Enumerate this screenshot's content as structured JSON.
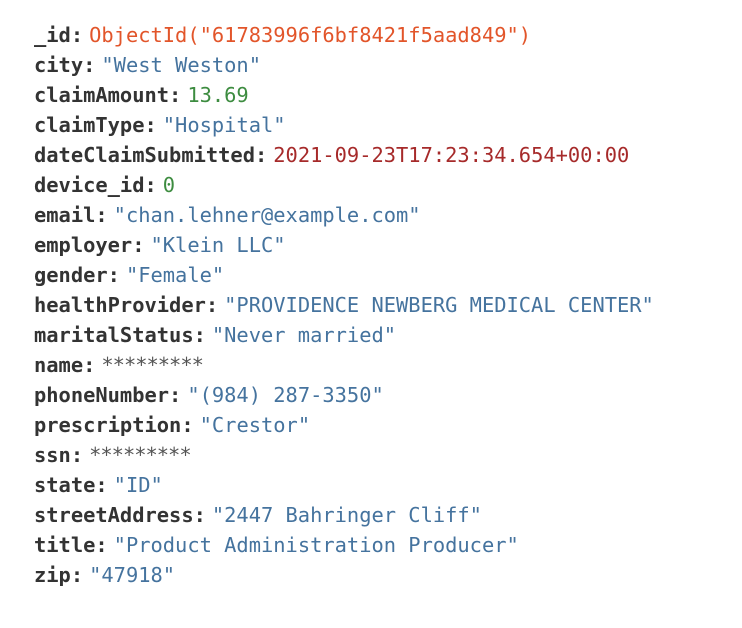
{
  "document": {
    "fields": [
      {
        "key": "_id",
        "value": "ObjectId(\"61783996f6bf8421f5aad849\")",
        "type": "objectid"
      },
      {
        "key": "city",
        "value": "\"West Weston\"",
        "type": "string"
      },
      {
        "key": "claimAmount",
        "value": "13.69",
        "type": "number"
      },
      {
        "key": "claimType",
        "value": "\"Hospital\"",
        "type": "string"
      },
      {
        "key": "dateClaimSubmitted",
        "value": "2021-09-23T17:23:34.654+00:00",
        "type": "date"
      },
      {
        "key": "device_id",
        "value": "0",
        "type": "number"
      },
      {
        "key": "email",
        "value": "\"chan.lehner@example.com\"",
        "type": "string"
      },
      {
        "key": "employer",
        "value": "\"Klein LLC\"",
        "type": "string"
      },
      {
        "key": "gender",
        "value": "\"Female\"",
        "type": "string"
      },
      {
        "key": "healthProvider",
        "value": "\"PROVIDENCE NEWBERG MEDICAL CENTER\"",
        "type": "string"
      },
      {
        "key": "maritalStatus",
        "value": "\"Never married\"",
        "type": "string"
      },
      {
        "key": "name",
        "value": "*********",
        "type": "masked"
      },
      {
        "key": "phoneNumber",
        "value": "\"(984) 287-3350\"",
        "type": "string"
      },
      {
        "key": "prescription",
        "value": "\"Crestor\"",
        "type": "string"
      },
      {
        "key": "ssn",
        "value": "*********",
        "type": "masked"
      },
      {
        "key": "state",
        "value": "\"ID\"",
        "type": "string"
      },
      {
        "key": "streetAddress",
        "value": "\"2447 Bahringer Cliff\"",
        "type": "string"
      },
      {
        "key": "title",
        "value": "\"Product Administration Producer\"",
        "type": "string"
      },
      {
        "key": "zip",
        "value": "\"47918\"",
        "type": "string"
      }
    ]
  },
  "colors": {
    "key": "#333333",
    "objectid": "#e2552a",
    "string": "#45739e",
    "number": "#3d8c40",
    "date": "#a62a2a",
    "masked": "#555555"
  }
}
